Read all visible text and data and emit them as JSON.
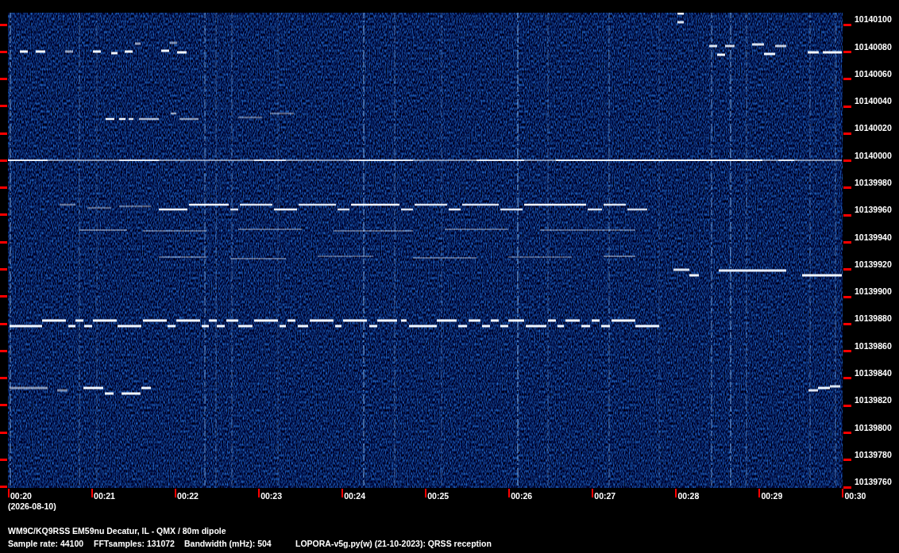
{
  "frequency_axis": {
    "labels": [
      "10140100",
      "10140080",
      "10140060",
      "10140040",
      "10140020",
      "10140000",
      "10139980",
      "10139960",
      "10139940",
      "10139920",
      "10139900",
      "10139880",
      "10139860",
      "10139840",
      "10139820",
      "10139800",
      "10139780",
      "10139760"
    ]
  },
  "time_axis": {
    "labels": [
      "00:20",
      "00:21",
      "00:22",
      "00:23",
      "00:24",
      "00:25",
      "00:26",
      "00:27",
      "00:28",
      "00:29",
      "00:30"
    ],
    "date": "(2026-08-10)"
  },
  "footer": {
    "station": "WM9C/KQ9RSS EM59nu Decatur, IL - QMX / 80m dipole",
    "settings": [
      "Sample rate: 44100",
      "FFTsamples: 131072",
      "Bandwidth (mHz): 504"
    ],
    "software": "LOPORA-v5g.py(w) (21-10-2023): QRSS reception"
  }
}
